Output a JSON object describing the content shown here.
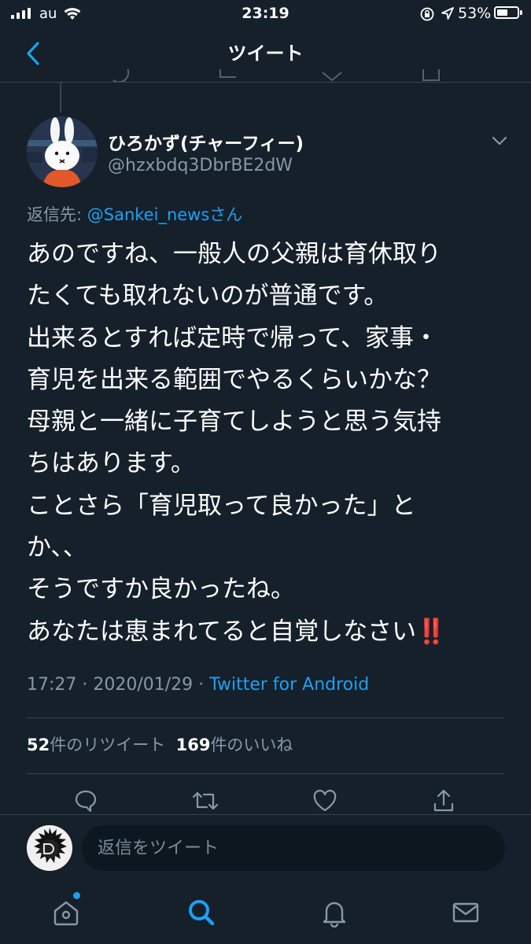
{
  "status_bar": {
    "carrier": "au",
    "time": "23:19",
    "battery": "53%",
    "battery_level": 0.53
  },
  "nav": {
    "title": "ツイート"
  },
  "tweet": {
    "display_name": "ひろかず(チャーフィー)",
    "handle": "@hzxbdq3DbrBE2dW",
    "reply_prefix": "返信先: ",
    "reply_mention": "@Sankei_newsさん",
    "lines": [
      "あのですね、一般人の父親は育休取り",
      "たくても取れないのが普通です。",
      "出来るとすれば定時で帰って、家事・",
      "育児を出来る範囲でやるくらいかな？",
      "母親と一緒に子育てしようと思う気持",
      "ちはあります。",
      "ことさら「育児取って良かった」と",
      "か、、",
      "そうですか良かったね。",
      "あなたは恵まれてると自覚しなさい"
    ],
    "emphasis": "‼️",
    "timestamp": "17:27 · 2020/01/29 · ",
    "source": "Twitter for Android",
    "retweet_count": "52",
    "retweet_label": "件のリツイート",
    "like_count": "169",
    "like_label": "件のいいね"
  },
  "actions": {
    "icons": [
      "reply-icon",
      "retweet-icon",
      "like-icon",
      "share-icon"
    ]
  },
  "reply_box": {
    "placeholder": "返信をツイート"
  },
  "tab_bar": {
    "icons": [
      "home-icon",
      "search-icon",
      "notifications-icon",
      "messages-icon"
    ]
  },
  "colors": {
    "background": "#15202b",
    "accent": "#1da1f2",
    "muted": "#8899a6",
    "divider": "#38444d"
  }
}
